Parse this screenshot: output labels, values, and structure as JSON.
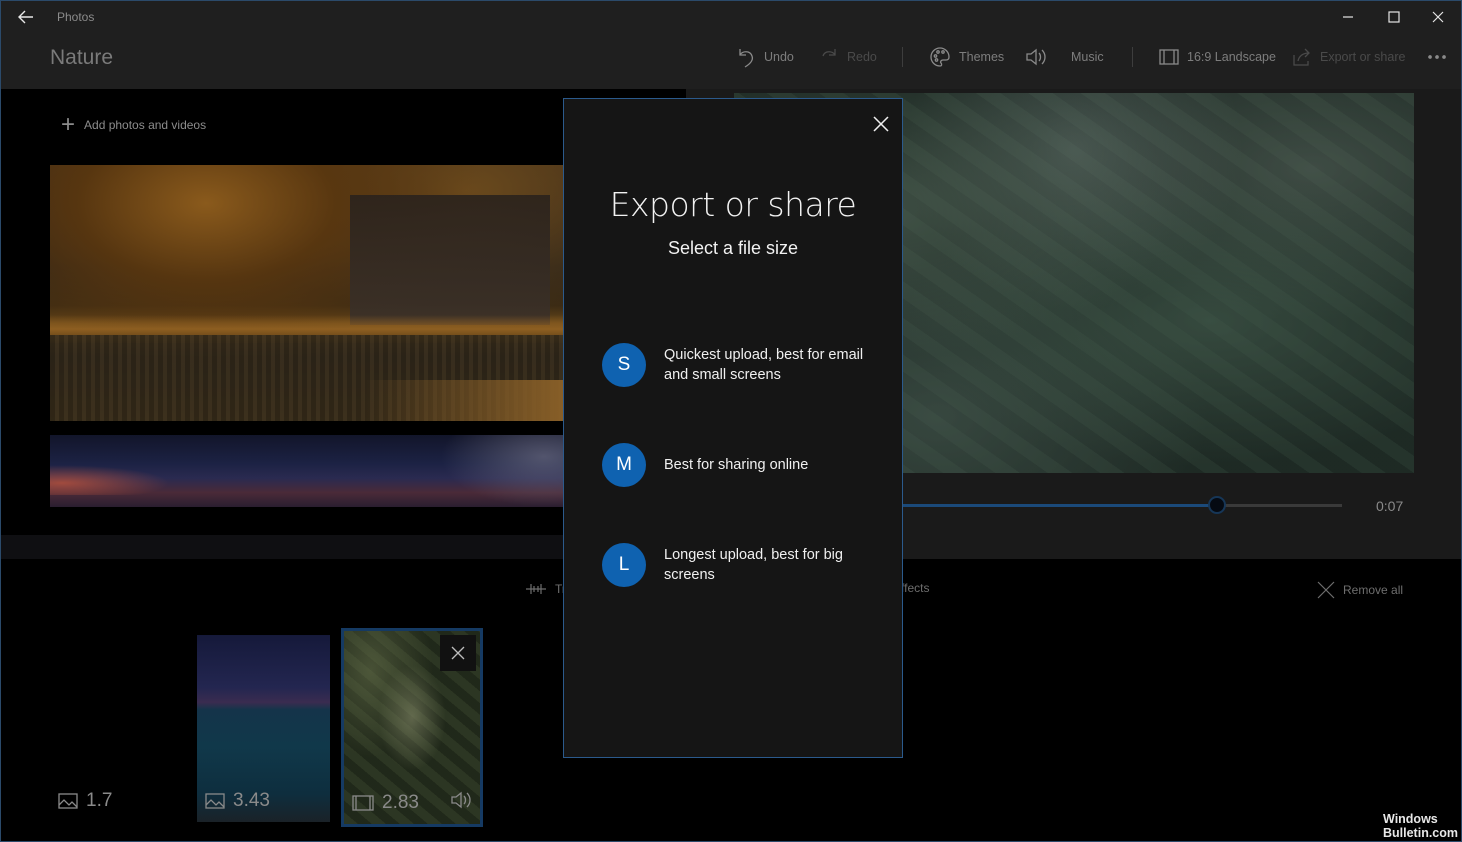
{
  "titlebar": {
    "app_name": "Photos",
    "back_icon": "arrow-left-icon",
    "controls": [
      "minimize-icon",
      "maximize-icon",
      "close-icon"
    ]
  },
  "header": {
    "project_title": "Nature",
    "toolbar": [
      {
        "label": "Undo",
        "icon": "undo-icon",
        "enabled": true
      },
      {
        "label": "Redo",
        "icon": "redo-icon",
        "enabled": false
      },
      {
        "label": "Themes",
        "icon": "palette-icon",
        "enabled": true
      },
      {
        "label": "Music",
        "icon": "speaker-icon",
        "enabled": true
      },
      {
        "label": "16:9 Landscape",
        "icon": "aspect-ratio-icon",
        "enabled": true
      },
      {
        "label": "Export or share",
        "icon": "share-icon",
        "enabled": false
      },
      {
        "label": "",
        "icon": "more-icon",
        "enabled": true
      }
    ]
  },
  "library": {
    "add_label": "Add photos and videos"
  },
  "preview": {
    "time": "0:07",
    "progress_fraction": 0.72
  },
  "storyboard": {
    "tools": [
      {
        "label": "Tr",
        "icon": "trim-icon"
      },
      {
        "label": "ffects",
        "icon": "effects-icon"
      },
      {
        "label": "Remove all",
        "icon": "remove-all-icon"
      }
    ],
    "cards": [
      {
        "type": "photo",
        "duration": "1.7",
        "icon": "image-icon",
        "selected": false,
        "has_audio": false
      },
      {
        "type": "photo",
        "duration": "3.43",
        "icon": "image-icon",
        "selected": false,
        "has_audio": false
      },
      {
        "type": "video",
        "duration": "2.83",
        "icon": "video-icon",
        "selected": true,
        "has_audio": true
      }
    ]
  },
  "dialog": {
    "title": "Export or share",
    "subtitle": "Select a file size",
    "options": [
      {
        "badge": "S",
        "label": "Quickest upload, best for email and small screens"
      },
      {
        "badge": "M",
        "label": "Best for sharing online"
      },
      {
        "badge": "L",
        "label": "Longest upload, best for big screens"
      }
    ],
    "accent_color": "#0f62b0"
  },
  "watermark": {
    "line1": "Windows",
    "line2": "Bulletin.com"
  }
}
